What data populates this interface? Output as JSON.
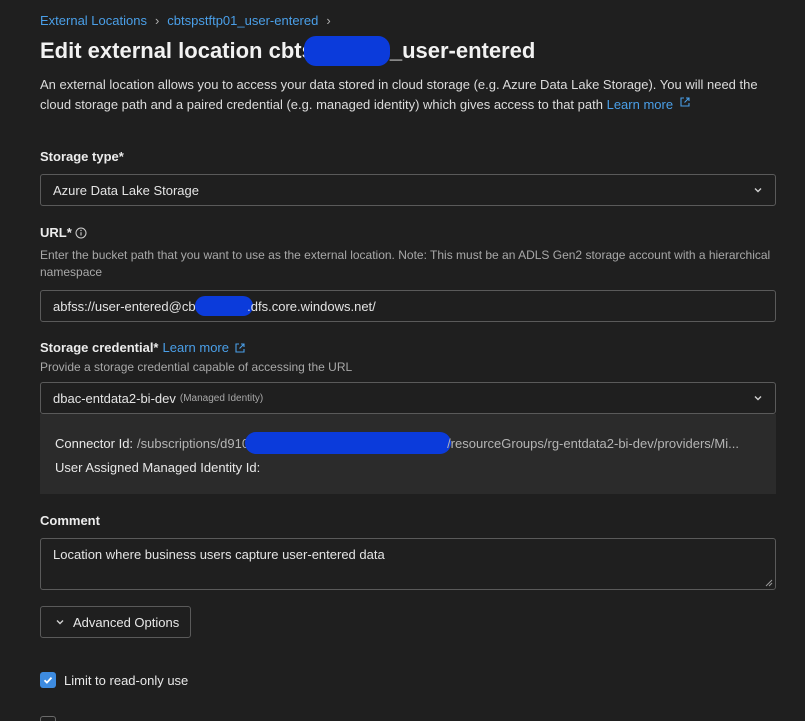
{
  "breadcrumb": {
    "items": [
      "External Locations",
      "cbtspstftp01_user-entered"
    ],
    "separator": "›"
  },
  "page": {
    "title_prefix": "Edit external location cbts",
    "title_suffix": "_user-entered",
    "description": "An external location allows you to access your data stored in cloud storage (e.g. Azure Data Lake Storage). You will need the cloud storage path and a paired credential (e.g. managed identity) which gives access to that path",
    "learn_more": "Learn more"
  },
  "storage_type": {
    "label": "Storage type*",
    "value": "Azure Data Lake Storage"
  },
  "url": {
    "label": "URL*",
    "help": "Enter the bucket path that you want to use as the external location. Note: This must be an ADLS Gen2 storage account with a hierarchical namespace",
    "value_prefix": "abfss://user-entered@cbt",
    "value_suffix": ".dfs.core.windows.net/"
  },
  "storage_credential": {
    "label": "Storage credential*",
    "learn_more": "Learn more",
    "help": "Provide a storage credential capable of accessing the URL",
    "value": "dbac-entdata2-bi-dev",
    "type_tag": "(Managed Identity)",
    "connector_key": "Connector Id:",
    "connector_prefix": "/subscriptions/d910",
    "connector_suffix": "/resourceGroups/rg-entdata2-bi-dev/providers/Mi...",
    "identity_key": "User Assigned Managed Identity Id:"
  },
  "comment": {
    "label": "Comment",
    "value": "Location where business users capture user-entered data"
  },
  "advanced": {
    "label": "Advanced Options"
  },
  "read_only": {
    "label": "Limit to read-only use",
    "checked": true
  },
  "colors": {
    "link": "#4a9fe8",
    "accent": "#3d8be0",
    "redaction": "#0b3bdb",
    "background": "#1f1f1f"
  }
}
